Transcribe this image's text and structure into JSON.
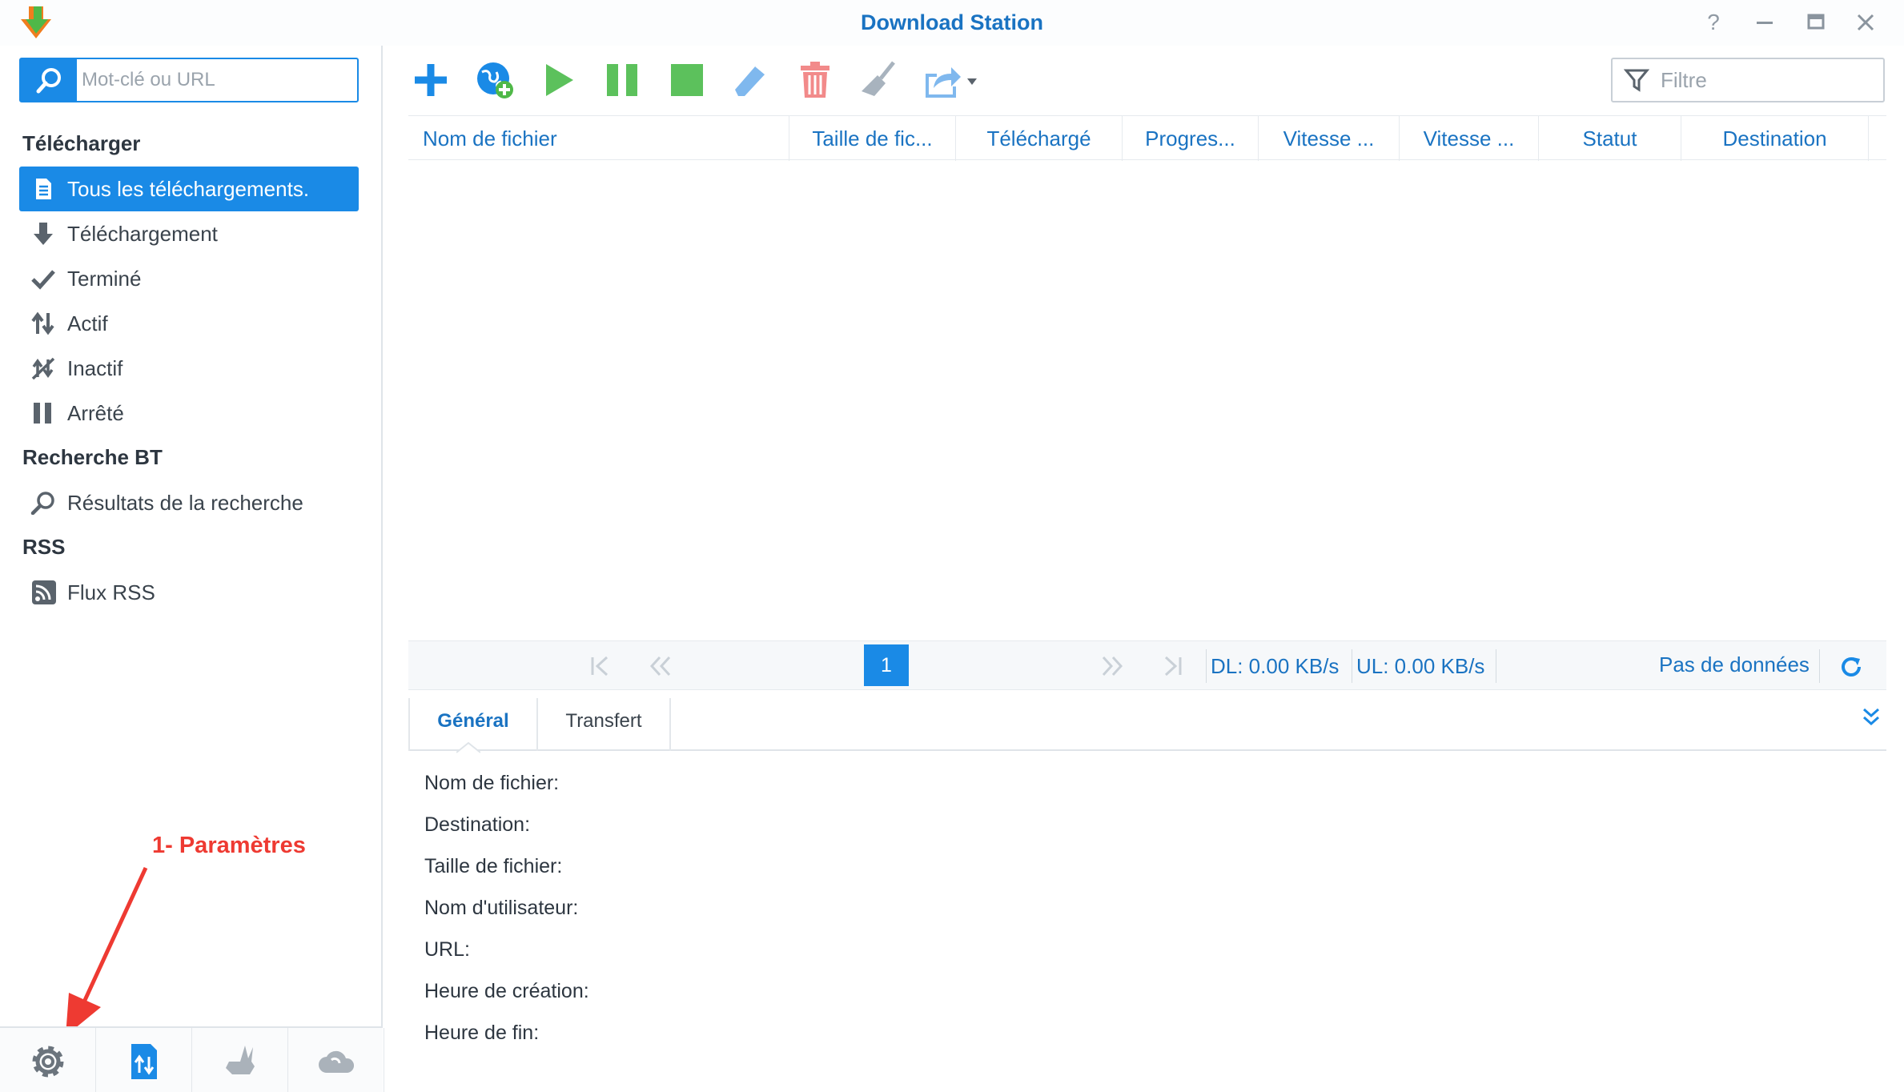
{
  "window": {
    "title": "Download Station",
    "help_glyph": "?"
  },
  "sidebar": {
    "search_placeholder": "Mot-clé ou URL",
    "sections": [
      {
        "title": "Télécharger",
        "items": [
          {
            "label": "Tous les téléchargements.",
            "icon": "document-icon",
            "active": true
          },
          {
            "label": "Téléchargement",
            "icon": "download-arrow-icon"
          },
          {
            "label": "Terminé",
            "icon": "checkmark-icon"
          },
          {
            "label": "Actif",
            "icon": "up-down-arrows-icon"
          },
          {
            "label": "Inactif",
            "icon": "inactive-icon"
          },
          {
            "label": "Arrêté",
            "icon": "pause-icon"
          }
        ]
      },
      {
        "title": "Recherche BT",
        "items": [
          {
            "label": "Résultats de la recherche",
            "icon": "search-icon"
          }
        ]
      },
      {
        "title": "RSS",
        "items": [
          {
            "label": "Flux RSS",
            "icon": "rss-icon"
          }
        ]
      }
    ],
    "bottom_buttons": [
      "settings-gear-icon",
      "transfer-icon",
      "emule-donkey-icon",
      "cloud-icon"
    ]
  },
  "annotation": {
    "text": "1- Paramètres",
    "color": "#ee3a32"
  },
  "toolbar": {
    "buttons": [
      "add-icon",
      "add-url-icon",
      "play-icon",
      "pause-icon",
      "stop-icon",
      "edit-icon",
      "delete-icon",
      "clean-icon",
      "share-dropdown-icon"
    ],
    "filter_placeholder": "Filtre"
  },
  "grid": {
    "columns": [
      "Nom de fichier",
      "Taille de fic...",
      "Téléchargé",
      "Progres...",
      "Vitesse ...",
      "Vitesse ...",
      "Statut",
      "Destination"
    ],
    "rows": []
  },
  "pager": {
    "current_page": "1",
    "dl_speed": "DL: 0.00 KB/s",
    "ul_speed": "UL: 0.00 KB/s",
    "no_data": "Pas de données"
  },
  "details": {
    "tabs": [
      "Général",
      "Transfert"
    ],
    "active_tab": "Général",
    "fields": [
      "Nom de fichier:",
      "Destination:",
      "Taille de fichier:",
      "Nom d'utilisateur:",
      "URL:",
      "Heure de création:",
      "Heure de fin:"
    ]
  },
  "colors": {
    "accent": "#1a8ae6",
    "title": "#1a73c2",
    "play_green": "#5cc15c",
    "delete_red": "#f28a8a"
  }
}
